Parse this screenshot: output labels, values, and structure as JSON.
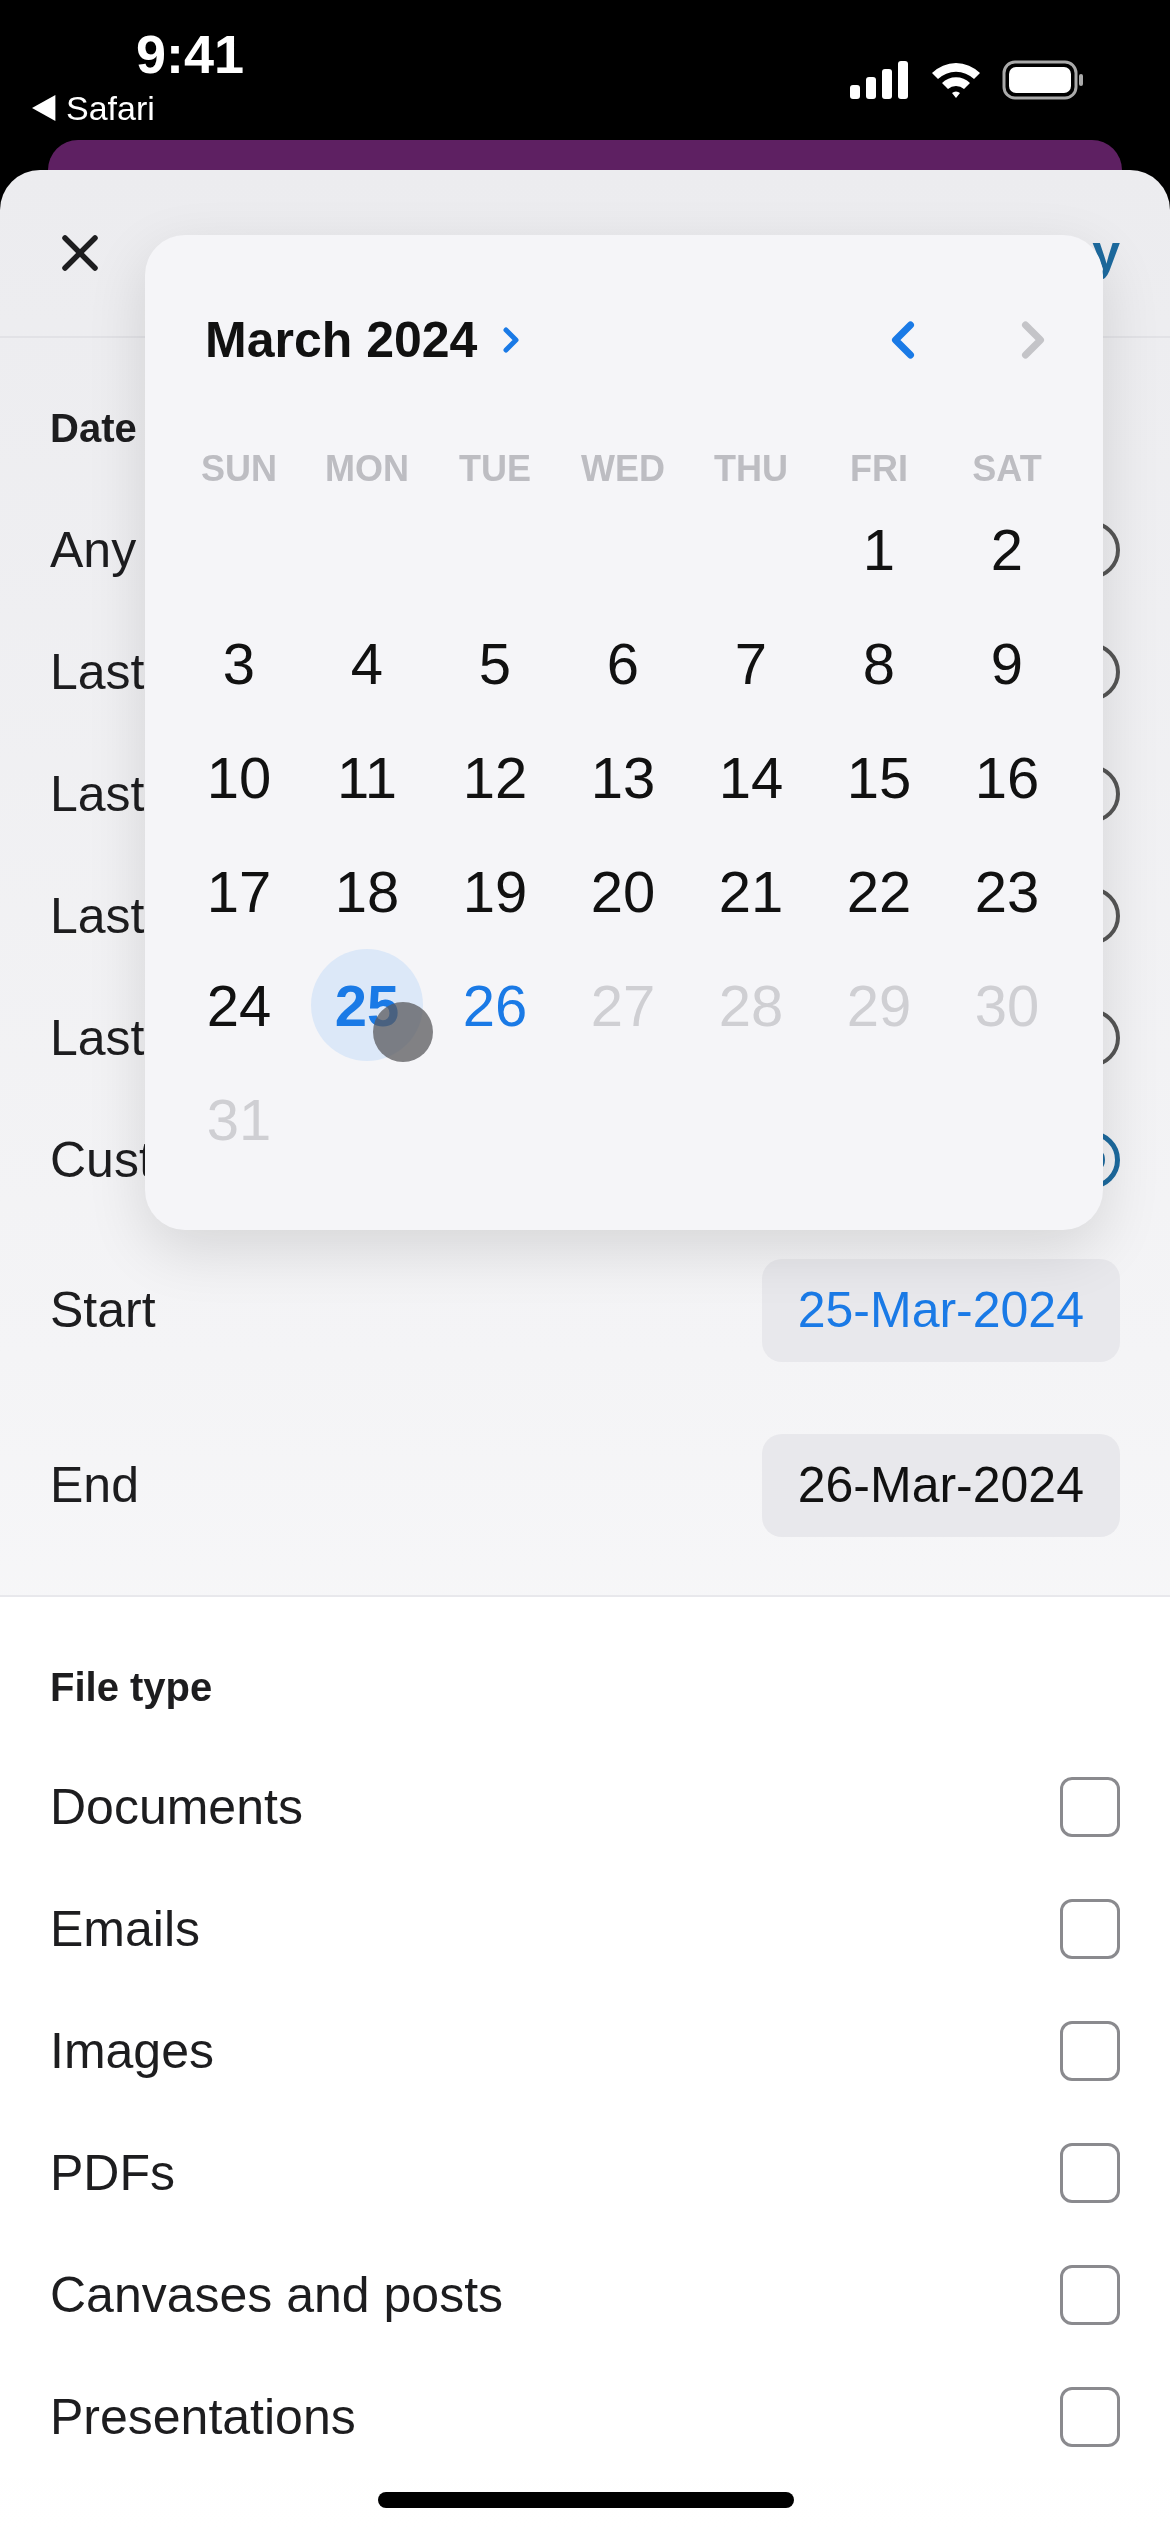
{
  "status_bar": {
    "time": "9:41",
    "back_label": "Safari"
  },
  "header": {
    "action": "y"
  },
  "date_section": {
    "title": "Date",
    "options": [
      {
        "label": "Any",
        "selected": false
      },
      {
        "label": "Last",
        "selected": false
      },
      {
        "label": "Last",
        "selected": false
      },
      {
        "label": "Last",
        "selected": false
      },
      {
        "label": "Last",
        "selected": false
      },
      {
        "label": "Cust",
        "selected": true
      }
    ],
    "start": {
      "label": "Start",
      "value": "25-Mar-2024",
      "active": true
    },
    "end": {
      "label": "End",
      "value": "26-Mar-2024",
      "active": false
    }
  },
  "calendar": {
    "title": "March 2024",
    "prev_disabled": false,
    "next_disabled": true,
    "weekdays": [
      "SUN",
      "MON",
      "TUE",
      "WED",
      "THU",
      "FRI",
      "SAT"
    ],
    "weeks": [
      {
        "days": [
          {
            "label": "1",
            "kind": "normal",
            "selected": false
          },
          {
            "label": "2",
            "kind": "normal",
            "selected": false
          }
        ]
      },
      {
        "days": [
          {
            "label": "3",
            "kind": "normal",
            "selected": false
          },
          {
            "label": "4",
            "kind": "normal",
            "selected": false
          },
          {
            "label": "5",
            "kind": "normal",
            "selected": false
          },
          {
            "label": "6",
            "kind": "normal",
            "selected": false
          },
          {
            "label": "7",
            "kind": "normal",
            "selected": false
          },
          {
            "label": "8",
            "kind": "normal",
            "selected": false
          },
          {
            "label": "9",
            "kind": "normal",
            "selected": false
          }
        ]
      },
      {
        "days": [
          {
            "label": "10",
            "kind": "normal",
            "selected": false
          },
          {
            "label": "11",
            "kind": "normal",
            "selected": false
          },
          {
            "label": "12",
            "kind": "normal",
            "selected": false
          },
          {
            "label": "13",
            "kind": "normal",
            "selected": false
          },
          {
            "label": "14",
            "kind": "normal",
            "selected": false
          },
          {
            "label": "15",
            "kind": "normal",
            "selected": false
          },
          {
            "label": "16",
            "kind": "normal",
            "selected": false
          }
        ]
      },
      {
        "days": [
          {
            "label": "17",
            "kind": "normal",
            "selected": false
          },
          {
            "label": "18",
            "kind": "normal",
            "selected": false
          },
          {
            "label": "19",
            "kind": "normal",
            "selected": false
          },
          {
            "label": "20",
            "kind": "normal",
            "selected": false
          },
          {
            "label": "21",
            "kind": "normal",
            "selected": false
          },
          {
            "label": "22",
            "kind": "normal",
            "selected": false
          },
          {
            "label": "23",
            "kind": "normal",
            "selected": false
          }
        ]
      },
      {
        "days": [
          {
            "label": "24",
            "kind": "normal",
            "selected": false
          },
          {
            "label": "25",
            "kind": "accent",
            "selected": true
          },
          {
            "label": "26",
            "kind": "accent",
            "selected": false
          },
          {
            "label": "27",
            "kind": "disabled",
            "selected": false
          },
          {
            "label": "28",
            "kind": "disabled",
            "selected": false
          },
          {
            "label": "29",
            "kind": "disabled",
            "selected": false
          },
          {
            "label": "30",
            "kind": "disabled",
            "selected": false
          }
        ]
      },
      {
        "days": [
          {
            "label": "31",
            "kind": "disabled",
            "selected": false
          }
        ]
      }
    ]
  },
  "file_type": {
    "title": "File type",
    "items": [
      {
        "label": "Documents",
        "checked": false
      },
      {
        "label": "Emails",
        "checked": false
      },
      {
        "label": "Images",
        "checked": false
      },
      {
        "label": "PDFs",
        "checked": false
      },
      {
        "label": "Canvases and posts",
        "checked": false
      },
      {
        "label": "Presentations",
        "checked": false
      }
    ]
  }
}
